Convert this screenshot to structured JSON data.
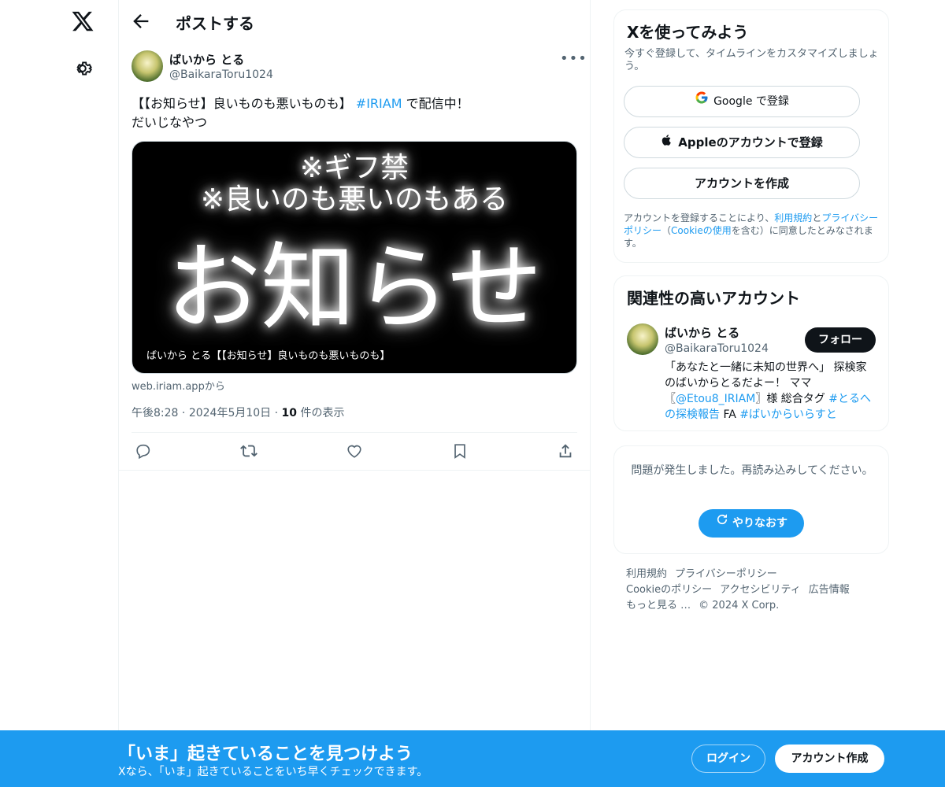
{
  "colors": {
    "accent": "#1d9bf0",
    "text": "#0f1419",
    "secondary": "#536471"
  },
  "nav": {
    "logo_icon": "x-logo-icon",
    "settings_icon": "gear-icon"
  },
  "header": {
    "title": "ポストする",
    "back_icon": "arrow-left-icon"
  },
  "post": {
    "author_name": "ばいから とる",
    "author_handle": "@BaikaraToru1024",
    "text_before": "【【お知らせ】良いものも悪いものも】 ",
    "hashtag": "#IRIAM",
    "text_after": " で配信中！",
    "text_line2": "だいじなやつ",
    "media": {
      "line1": "※ギフ禁",
      "line2": "※良いのも悪いのもある",
      "line3": "お知らせ",
      "caption": "ばいから とる【【お知らせ】良いものも悪いものも】"
    },
    "link_source": "web.iriam.appから",
    "time": "午後8:28",
    "date": "2024年5月10日",
    "views_count": "10",
    "views_label": " 件の表示",
    "separator": " · "
  },
  "signup_card": {
    "title": "Xを使ってみよう",
    "subtitle": "今すぐ登録して、タイムラインをカスタマイズしましょう。",
    "google_label": "Google で登録",
    "apple_label": "Appleのアカウントで登録",
    "create_label": "アカウントを作成",
    "legal_prefix": "アカウントを登録することにより、",
    "legal_terms": "利用規約",
    "legal_and": "と",
    "legal_privacy": "プライバシーポリシー",
    "legal_paren_open": "（",
    "legal_cookie": "Cookieの使用",
    "legal_suffix": "を含む）に同意したとみなされます。"
  },
  "related": {
    "title": "関連性の高いアカウント",
    "name": "ばいから とる",
    "handle": "@BaikaraToru1024",
    "follow_label": "フォロー",
    "bio_1": "「あなたと一緒に未知の世界へ」 探検家のばいからとるだよー！ ママ〖",
    "bio_mention": "@Etou8_IRIAM",
    "bio_2": "〗様 総合タグ ",
    "bio_tag1": "#とるへの探検報告",
    "bio_3": " FA ",
    "bio_tag2": "#ばいからいらすと"
  },
  "error_card": {
    "message": "問題が発生しました。再読み込みしてください。",
    "retry_label": "やりなおす"
  },
  "footer": {
    "terms": "利用規約",
    "privacy": "プライバシーポリシー",
    "cookie": "Cookieのポリシー",
    "accessibility": "アクセシビリティ",
    "ads": "広告情報",
    "more": "もっと見る …",
    "copyright": "© 2024 X Corp."
  },
  "bottom_bar": {
    "title": "「いま」起きていることを見つけよう",
    "subtitle": "Xなら、「いま」起きていることをいち早くチェックできます。",
    "login_label": "ログイン",
    "signup_label": "アカウント作成"
  }
}
